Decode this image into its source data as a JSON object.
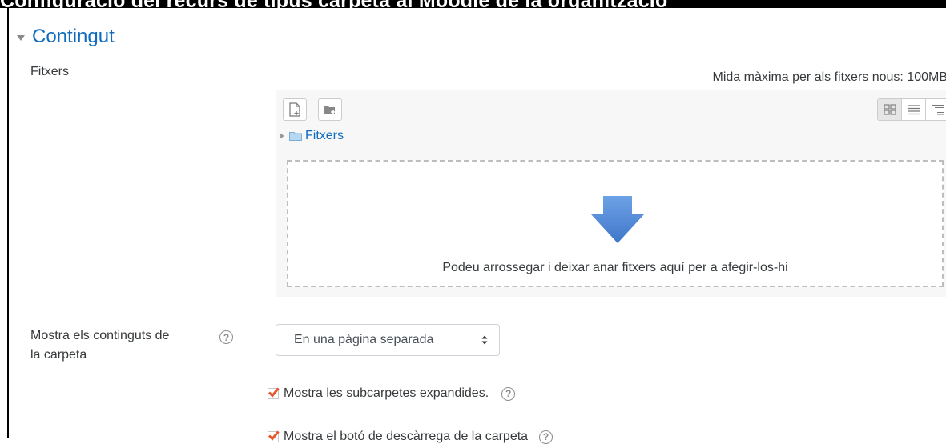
{
  "header_cut": "Configuració del recurs de tipus carpeta al Moodle de la organització",
  "section": {
    "title": "Contingut"
  },
  "files": {
    "label": "Fitxers",
    "max_size": "Mida màxima per als fitxers nous: 100MB",
    "path": "Fitxers",
    "drop_message": "Podeu arrossegar i deixar anar fitxers aquí per a afegir-los-hi",
    "toolbar_icons": [
      "add-file-icon",
      "create-folder-icon"
    ],
    "view_icons": [
      "icon-view-icon",
      "list-view-icon",
      "tree-view-icon"
    ]
  },
  "display": {
    "label_line1": "Mostra els continguts de",
    "label_line2": "la carpeta",
    "selected": "En una pàgina separada"
  },
  "options": [
    {
      "label": "Mostra les subcarpetes expandides.",
      "checked": true
    },
    {
      "label": "Mostra el botó de descàrrega de la carpeta",
      "checked": true
    }
  ],
  "colors": {
    "link": "#0f6cbf",
    "checkbox": "#e8572f",
    "arrow": "#4a87d8"
  }
}
